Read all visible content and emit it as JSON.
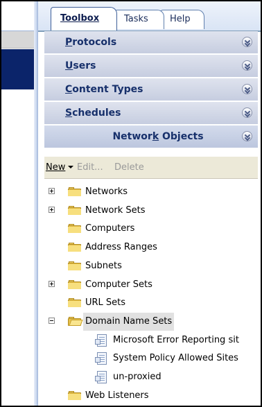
{
  "tabs": [
    {
      "label": "Toolbox",
      "active": true
    },
    {
      "label": "Tasks",
      "active": false
    },
    {
      "label": "Help",
      "active": false
    }
  ],
  "sections": [
    {
      "label_pre": "",
      "label_key": "P",
      "label_post": "rotocols",
      "icon": "chevron-down-icon"
    },
    {
      "label_pre": "",
      "label_key": "U",
      "label_post": "sers",
      "icon": "chevron-down-icon"
    },
    {
      "label_pre": "",
      "label_key": "C",
      "label_post": "ontent Types",
      "icon": "chevron-down-icon"
    },
    {
      "label_pre": "",
      "label_key": "S",
      "label_post": "chedules",
      "icon": "chevron-down-icon"
    },
    {
      "label_pre": "Networ",
      "label_key": "k",
      "label_post": " Objects",
      "icon": "chevron-down-icon"
    }
  ],
  "toolbar": {
    "new_label": "New",
    "edit_label": "Edit...",
    "delete_label": "Delete"
  },
  "tree": [
    {
      "label": "Networks",
      "expander": "plus",
      "icon": "folder-icon",
      "indent": 0
    },
    {
      "label": "Network Sets",
      "expander": "plus",
      "icon": "folder-icon",
      "indent": 0
    },
    {
      "label": "Computers",
      "expander": "none",
      "icon": "folder-icon",
      "indent": 0
    },
    {
      "label": "Address Ranges",
      "expander": "none",
      "icon": "folder-icon",
      "indent": 0
    },
    {
      "label": "Subnets",
      "expander": "none",
      "icon": "folder-icon",
      "indent": 0
    },
    {
      "label": "Computer Sets",
      "expander": "plus",
      "icon": "folder-icon",
      "indent": 0
    },
    {
      "label": "URL Sets",
      "expander": "none",
      "icon": "folder-icon",
      "indent": 0
    },
    {
      "label": "Domain Name Sets",
      "expander": "minus",
      "icon": "open-folder-icon",
      "indent": 0,
      "selected": true
    },
    {
      "label": "Microsoft Error Reporting sit",
      "expander": "none",
      "icon": "document-icon",
      "indent": 1
    },
    {
      "label": "System Policy Allowed Sites",
      "expander": "none",
      "icon": "document-icon",
      "indent": 1
    },
    {
      "label": "un-proxied",
      "expander": "none",
      "icon": "document-icon",
      "indent": 1
    },
    {
      "label": "Web Listeners",
      "expander": "none",
      "icon": "folder-icon",
      "indent": 0
    }
  ],
  "colors": {
    "section_text": "#17306b",
    "left_selection": "#0b246a",
    "toolbar_bg": "#ece9d8"
  }
}
